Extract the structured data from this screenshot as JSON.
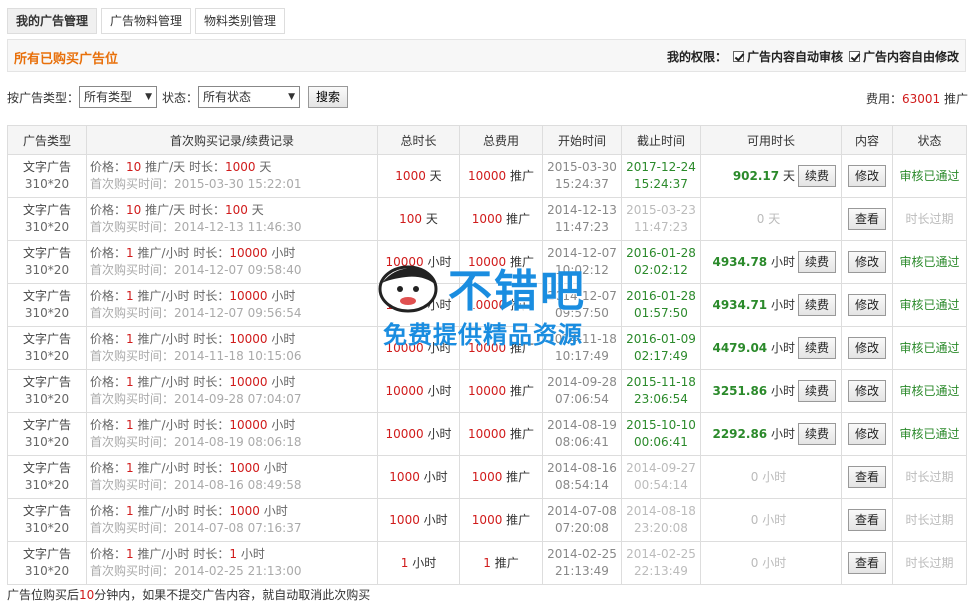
{
  "tabs": [
    "我的广告管理",
    "广告物料管理",
    "物料类别管理"
  ],
  "panel_title": "所有已购买广告位",
  "permissions": {
    "label": "我的权限：",
    "items": [
      "广告内容自动审核",
      "广告内容自由修改"
    ]
  },
  "filter": {
    "type_label": "按广告类型：",
    "type_value": "所有类型",
    "status_label": "状态：",
    "status_value": "所有状态",
    "search_button": "搜索"
  },
  "fee": {
    "label": "费用：",
    "value": "63001",
    "unit": "推广"
  },
  "table": {
    "headers": [
      "广告类型",
      "首次购买记录/续费记录",
      "总时长",
      "总费用",
      "开始时间",
      "截止时间",
      "可用时长",
      "内容",
      "状态"
    ],
    "rows": [
      {
        "type": "文字广告",
        "size": "310*20",
        "price": "10",
        "price_unit": "推广/天",
        "dur": "1000",
        "dur_unit": "天",
        "first": "2015-03-30 15:22:01",
        "total_dur": "1000",
        "total_dur_unit": "天",
        "total_fee": "10000",
        "fee_unit": "推广",
        "start_d": "2015-03-30",
        "start_t": "15:24:37",
        "end_d": "2017-12-24",
        "end_t": "15:24:37",
        "avail": "902.17",
        "avail_unit": "天",
        "renew": "续费",
        "action": "修改",
        "status": "审核已通过",
        "active": true
      },
      {
        "type": "文字广告",
        "size": "310*20",
        "price": "10",
        "price_unit": "推广/天",
        "dur": "100",
        "dur_unit": "天",
        "first": "2014-12-13 11:46:30",
        "total_dur": "100",
        "total_dur_unit": "天",
        "total_fee": "1000",
        "fee_unit": "推广",
        "start_d": "2014-12-13",
        "start_t": "11:47:23",
        "end_d": "2015-03-23",
        "end_t": "11:47:23",
        "avail": "0",
        "avail_unit": "天",
        "renew": "",
        "action": "查看",
        "status": "时长过期",
        "active": false
      },
      {
        "type": "文字广告",
        "size": "310*20",
        "price": "1",
        "price_unit": "推广/小时",
        "dur": "10000",
        "dur_unit": "小时",
        "first": "2014-12-07 09:58:40",
        "total_dur": "10000",
        "total_dur_unit": "小时",
        "total_fee": "10000",
        "fee_unit": "推广",
        "start_d": "2014-12-07",
        "start_t": "10:02:12",
        "end_d": "2016-01-28",
        "end_t": "02:02:12",
        "avail": "4934.78",
        "avail_unit": "小时",
        "renew": "续费",
        "action": "修改",
        "status": "审核已通过",
        "active": true
      },
      {
        "type": "文字广告",
        "size": "310*20",
        "price": "1",
        "price_unit": "推广/小时",
        "dur": "10000",
        "dur_unit": "小时",
        "first": "2014-12-07 09:56:54",
        "total_dur": "10000",
        "total_dur_unit": "小时",
        "total_fee": "10000",
        "fee_unit": "推广",
        "start_d": "2014-12-07",
        "start_t": "09:57:50",
        "end_d": "2016-01-28",
        "end_t": "01:57:50",
        "avail": "4934.71",
        "avail_unit": "小时",
        "renew": "续费",
        "action": "修改",
        "status": "审核已通过",
        "active": true
      },
      {
        "type": "文字广告",
        "size": "310*20",
        "price": "1",
        "price_unit": "推广/小时",
        "dur": "10000",
        "dur_unit": "小时",
        "first": "2014-11-18 10:15:06",
        "total_dur": "10000",
        "total_dur_unit": "小时",
        "total_fee": "10000",
        "fee_unit": "推广",
        "start_d": "2014-11-18",
        "start_t": "10:17:49",
        "end_d": "2016-01-09",
        "end_t": "02:17:49",
        "avail": "4479.04",
        "avail_unit": "小时",
        "renew": "续费",
        "action": "修改",
        "status": "审核已通过",
        "active": true
      },
      {
        "type": "文字广告",
        "size": "310*20",
        "price": "1",
        "price_unit": "推广/小时",
        "dur": "10000",
        "dur_unit": "小时",
        "first": "2014-09-28 07:04:07",
        "total_dur": "10000",
        "total_dur_unit": "小时",
        "total_fee": "10000",
        "fee_unit": "推广",
        "start_d": "2014-09-28",
        "start_t": "07:06:54",
        "end_d": "2015-11-18",
        "end_t": "23:06:54",
        "avail": "3251.86",
        "avail_unit": "小时",
        "renew": "续费",
        "action": "修改",
        "status": "审核已通过",
        "active": true
      },
      {
        "type": "文字广告",
        "size": "310*20",
        "price": "1",
        "price_unit": "推广/小时",
        "dur": "10000",
        "dur_unit": "小时",
        "first": "2014-08-19 08:06:18",
        "total_dur": "10000",
        "total_dur_unit": "小时",
        "total_fee": "10000",
        "fee_unit": "推广",
        "start_d": "2014-08-19",
        "start_t": "08:06:41",
        "end_d": "2015-10-10",
        "end_t": "00:06:41",
        "avail": "2292.86",
        "avail_unit": "小时",
        "renew": "续费",
        "action": "修改",
        "status": "审核已通过",
        "active": true
      },
      {
        "type": "文字广告",
        "size": "310*20",
        "price": "1",
        "price_unit": "推广/小时",
        "dur": "1000",
        "dur_unit": "小时",
        "first": "2014-08-16 08:49:58",
        "total_dur": "1000",
        "total_dur_unit": "小时",
        "total_fee": "1000",
        "fee_unit": "推广",
        "start_d": "2014-08-16",
        "start_t": "08:54:14",
        "end_d": "2014-09-27",
        "end_t": "00:54:14",
        "avail": "0",
        "avail_unit": "小时",
        "renew": "",
        "action": "查看",
        "status": "时长过期",
        "active": false
      },
      {
        "type": "文字广告",
        "size": "310*20",
        "price": "1",
        "price_unit": "推广/小时",
        "dur": "1000",
        "dur_unit": "小时",
        "first": "2014-07-08 07:16:37",
        "total_dur": "1000",
        "total_dur_unit": "小时",
        "total_fee": "1000",
        "fee_unit": "推广",
        "start_d": "2014-07-08",
        "start_t": "07:20:08",
        "end_d": "2014-08-18",
        "end_t": "23:20:08",
        "avail": "0",
        "avail_unit": "小时",
        "renew": "",
        "action": "查看",
        "status": "时长过期",
        "active": false
      },
      {
        "type": "文字广告",
        "size": "310*20",
        "price": "1",
        "price_unit": "推广/小时",
        "dur": "1",
        "dur_unit": "小时",
        "first": "2014-02-25 21:13:00",
        "total_dur": "1",
        "total_dur_unit": "小时",
        "total_fee": "1",
        "fee_unit": "推广",
        "start_d": "2014-02-25",
        "start_t": "21:13:49",
        "end_d": "2014-02-25",
        "end_t": "22:13:49",
        "avail": "0",
        "avail_unit": "小时",
        "renew": "",
        "action": "查看",
        "status": "时长过期",
        "active": false
      }
    ],
    "labels": {
      "price": "价格：",
      "dur": "时长：",
      "first": "首次购买时间："
    }
  },
  "footnote": {
    "pre": "广告位购买后",
    "num": "10",
    "post": "分钟内，如果不提交广告内容，就自动取消此次购买"
  },
  "watermark": {
    "brand": "不错吧",
    "tagline": "免费提供精品资源"
  }
}
